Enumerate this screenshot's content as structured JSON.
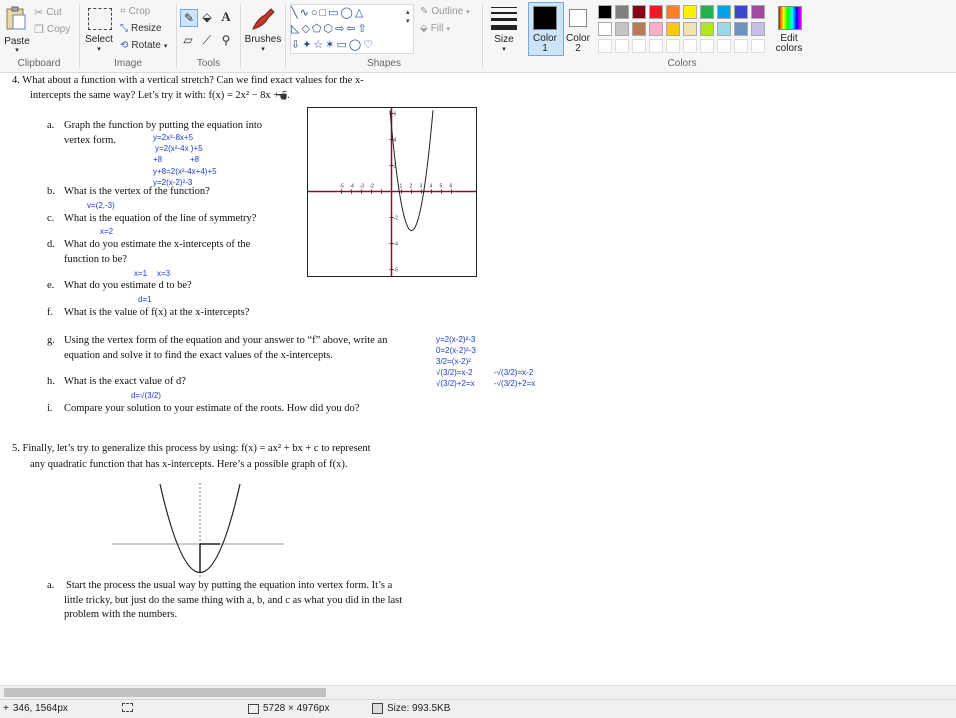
{
  "ribbon": {
    "clipboard": {
      "paste": "Paste",
      "cut": "Cut",
      "copy": "Copy",
      "label": "Clipboard"
    },
    "image": {
      "select": "Select",
      "crop": "Crop",
      "resize": "Resize",
      "rotate": "Rotate",
      "label": "Image"
    },
    "tools": {
      "label": "Tools",
      "text_tool": "A"
    },
    "brushes": {
      "label": "Brushes"
    },
    "shapes": {
      "outline": "Outline",
      "fill": "Fill",
      "label": "Shapes"
    },
    "size": {
      "label": "Size"
    },
    "color1": {
      "label1": "Color",
      "label2": "1",
      "value": "#000000"
    },
    "color2": {
      "label1": "Color",
      "label2": "2",
      "value": "#ffffff"
    },
    "colors": {
      "label": "Colors",
      "edit1": "Edit",
      "edit2": "colors",
      "row1": [
        "#000000",
        "#7f7f7f",
        "#880015",
        "#ed1c24",
        "#ff7f27",
        "#fff200",
        "#22b14c",
        "#00a2e8",
        "#3f48cc",
        "#a349a4"
      ],
      "row2": [
        "#ffffff",
        "#c3c3c3",
        "#b97a57",
        "#ffaec9",
        "#ffc90e",
        "#efe4b0",
        "#b5e61d",
        "#99d9ea",
        "#7092be",
        "#c8bfe7"
      ]
    }
  },
  "doc": {
    "q4_line1": "4.   What about a function with a vertical stretch?  Can we find exact values for the x-",
    "q4_line2": "intercepts the same way?  Let’s try it with:  f(x) = 2x² − 8x + 5.",
    "a_label": "a.",
    "a_text1": "Graph the function by putting the equation into",
    "a_text2": "vertex form.",
    "hw_a1": "y=2x²-8x+5",
    "hw_a2": "y=2(x²-4x    )+5",
    "hw_a3a": "+8",
    "hw_a3b": "+8",
    "hw_a4": "y+8=2(x²-4x+4)+5",
    "hw_a5": "y=2(x-2)²-3",
    "b_label": "b.",
    "b_text": "What is the vertex of the function?",
    "hw_b": "v=(2,-3)",
    "c_label": "c.",
    "c_text": "What is the equation of the line of symmetry?",
    "hw_c": "x=2",
    "d_label": "d.",
    "d_text1": "What do you estimate the x-intercepts of the",
    "d_text2": "function to be?",
    "hw_d1": "x=1",
    "hw_d2": "x=3",
    "e_label": "e.",
    "e_text": "What do you estimate d to be?",
    "hw_e": "d=1",
    "f_label": "f.",
    "f_text": "What is the value of f(x) at the x-intercepts?",
    "g_label": "g.",
    "g_text1": "Using the vertex form of the equation and your answer to “f” above, write an",
    "g_text2": "equation and solve it to find the exact values of the x-intercepts.",
    "hw_g1": "y=2(x-2)²-3",
    "hw_g2": "0=2(x-2)²-3",
    "hw_g3": "3/2=(x-2)²",
    "hw_g4a": "√(3/2)=x-2",
    "hw_g4b": "-√(3/2)=x-2",
    "hw_g5a": "√(3/2)+2=x",
    "hw_g5b": "-√(3/2)+2=x",
    "h_label": "h.",
    "h_text": "What is the exact value of d?",
    "hw_h": "d=√(3/2)",
    "i_label": "i.",
    "i_text": "Compare your solution to your estimate of the roots.  How did you do?",
    "q5_line1": "5.   Finally, let’s try to generalize this process by using:  f(x) = ax² + bx + c  to represent",
    "q5_line2": "any quadratic function that has x-intercepts.  Here’s a possible graph of f(x).",
    "q5a_label": "a.",
    "q5a_text1": "Start the process the usual way by putting the equation into vertex form. It’s a",
    "q5a_text2": "little tricky, but just do the same thing with a, b, and c as what you did in the last",
    "q5a_text3": "problem with the numbers."
  },
  "graph1": {
    "x_ticks": [
      "-5",
      "-4",
      "-3",
      "-2",
      "-1",
      "1",
      "2",
      "3",
      "4",
      "5",
      "6"
    ],
    "y_ticks": [
      "6",
      "4",
      "2",
      "-2",
      "-4",
      "-6"
    ]
  },
  "status": {
    "cursor": "346, 1564px",
    "dimensions": "5728 × 4976px",
    "size": "Size: 993.5KB"
  }
}
